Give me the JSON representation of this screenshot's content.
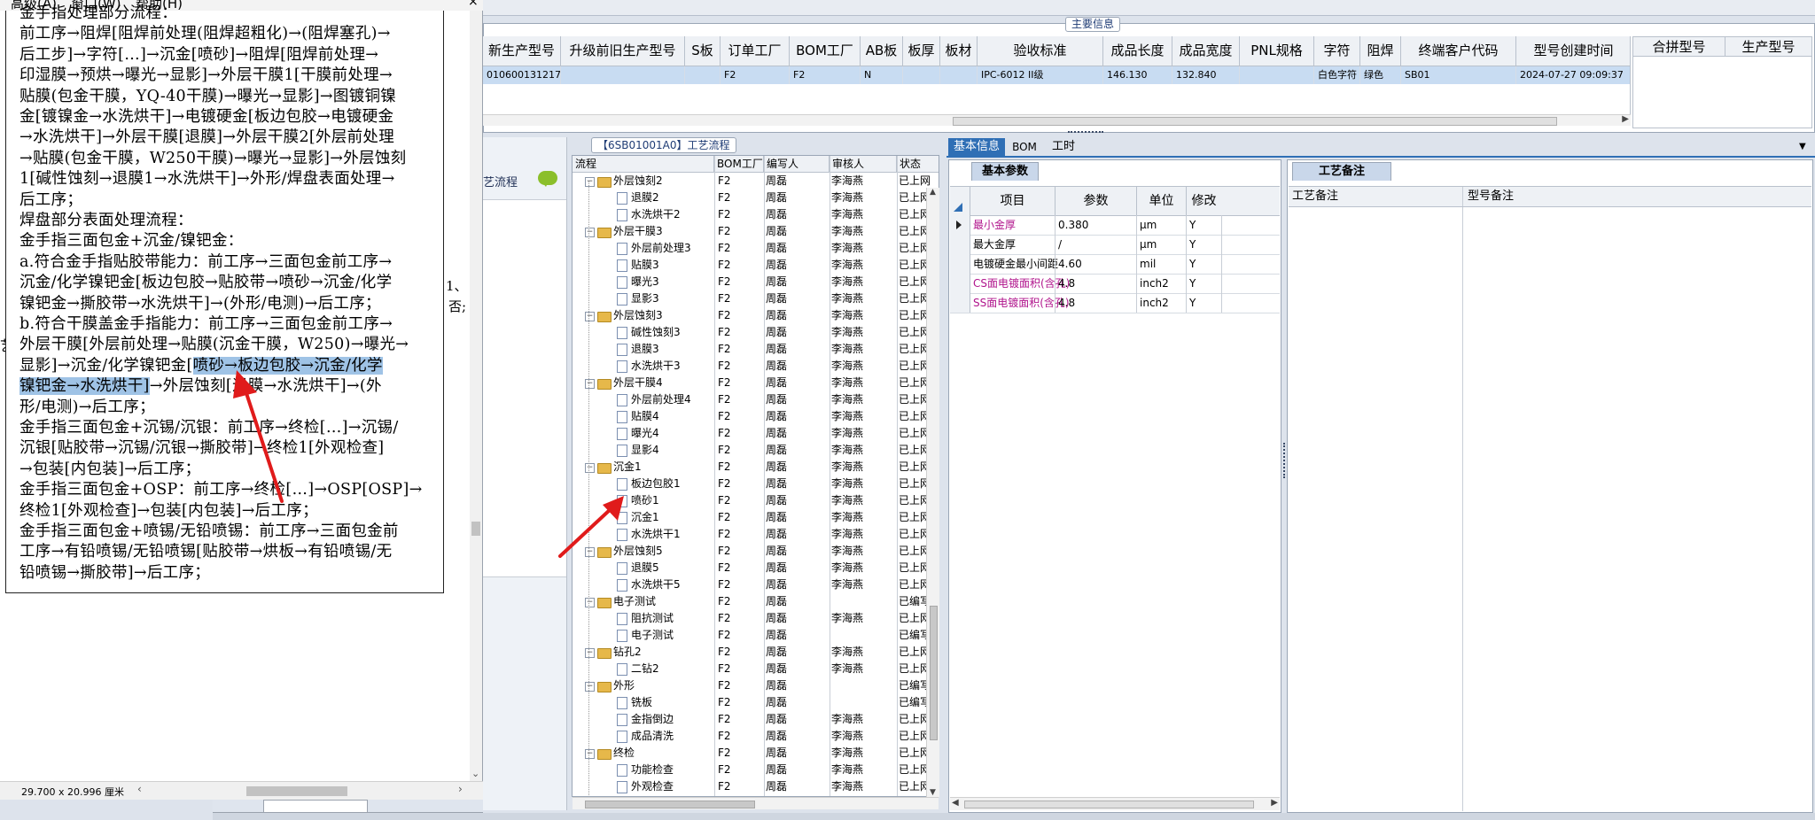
{
  "doc_panel": {
    "menu": [
      "高级(A)",
      "窗口(W)",
      "帮助(H)"
    ],
    "lines": [
      {
        "t": "金手指处理部分流程："
      },
      {
        "t": "前工序→阻焊[阻焊前处理(阻焊超粗化)→(阻焊塞孔)→"
      },
      {
        "t": "后工步]→字符[…]→沉金[喷砂]→阻焊[阻焊前处理→"
      },
      {
        "t": "印湿膜→预烘→曝光→显影]→外层干膜1[干膜前处理→"
      },
      {
        "t": "贴膜(包金干膜，YQ-40干膜)→曝光→显影]→图镀铜镍"
      },
      {
        "t": "金[镀镍金→水洗烘干]→电镀硬金[板边包胶→电镀硬金"
      },
      {
        "t": "→水洗烘干]→外层干膜[退膜]→外层干膜2[外层前处理"
      },
      {
        "t": "→贴膜(包金干膜，W250干膜)→曝光→显影]→外层蚀刻"
      },
      {
        "t": "1[碱性蚀刻→退膜1→水洗烘干]→外形/焊盘表面处理→"
      },
      {
        "t": "后工序；"
      },
      {
        "t": "焊盘部分表面处理流程："
      },
      {
        "t": "金手指三面包金+沉金/镍钯金："
      },
      {
        "t": "a.符合金手指贴胶带能力：前工序→三面包金前工序→"
      },
      {
        "t": "沉金/化学镍钯金[板边包胶→贴胶带→喷砂→沉金/化学"
      },
      {
        "t": "镍钯金→撕胶带→水洗烘干]→(外形/电测)→后工序；"
      },
      {
        "t": "b.符合干膜盖金手指能力：前工序→三面包金前工序→"
      },
      {
        "t": "外层干膜[外层前处理→贴膜(沉金干膜，W250)→曝光→"
      },
      {
        "pre": "显影]→沉金/化学镍钯金[",
        "hl": "喷砂→板边包胶→沉金/化学"
      },
      {
        "hl": "镍钯金→水洗烘干]",
        "post": "→外层蚀刻[退膜→水洗烘干]→(外"
      },
      {
        "t": "形/电测)→后工序；"
      },
      {
        "t": "金手指三面包金+沉锡/沉银：前工序→终检[…]→沉锡/"
      },
      {
        "t": "沉银[贴胶带→沉锡/沉银→撕胶带]→终检1[外观检查]"
      },
      {
        "t": "→包装[内包装]→后工序；"
      },
      {
        "t": "金手指三面包金+OSP：前工序→终检[…]→OSP[OSP]→"
      },
      {
        "t": "终检1[外观检查]→包装[内包装]→后工序；"
      },
      {
        "t": "金手指三面包金+喷锡/无铅喷锡：前工序→三面包金前"
      },
      {
        "t": "工序→有铅喷锡/无铅喷锡[贴胶带→烘板→有铅喷锡/无"
      },
      {
        "t": "铅喷锡→撕胶带]→后工序；"
      }
    ],
    "page_size": "29.700 x 20.996 厘米",
    "side_text": [
      "1、",
      "否;"
    ],
    "left_edge_char": "艺"
  },
  "main_info": {
    "title": "主要信息",
    "columns": [
      "新生产型号",
      "升级前旧生产型号",
      "S板",
      "订单工厂",
      "BOM工厂",
      "AB板",
      "板厚",
      "板材",
      "验收标准",
      "成品长度",
      "成品宽度",
      "PNL规格",
      "字符",
      "阻焊",
      "终端客户代码",
      "型号创建时间"
    ],
    "row": [
      "010600131217",
      "",
      "",
      "F2",
      "F2",
      "N",
      "",
      "",
      "IPC-6012 II级",
      "146.130",
      "132.840",
      "",
      "白色字符",
      "绿色",
      "SB01",
      "2024-07-27 09:09:37"
    ],
    "right_columns": [
      "合拼型号",
      "生产型号"
    ]
  },
  "process_flow": {
    "title": "【6SB01001A0】工艺流程",
    "left_label": "艺流程",
    "columns": [
      "流程",
      "BOM工厂",
      "编写人",
      "审核人",
      "状态"
    ],
    "rows": [
      {
        "level": 1,
        "name": "外层蚀刻2",
        "bom": "F2",
        "writer": "周磊",
        "reviewer": "李海燕",
        "status": "已上网"
      },
      {
        "level": 2,
        "name": "退膜2",
        "bom": "F2",
        "writer": "周磊",
        "reviewer": "李海燕",
        "status": "已上网"
      },
      {
        "level": 2,
        "name": "水洗烘干2",
        "bom": "F2",
        "writer": "周磊",
        "reviewer": "李海燕",
        "status": "已上网"
      },
      {
        "level": 1,
        "name": "外层干膜3",
        "bom": "F2",
        "writer": "周磊",
        "reviewer": "李海燕",
        "status": "已上网"
      },
      {
        "level": 2,
        "name": "外层前处理3",
        "bom": "F2",
        "writer": "周磊",
        "reviewer": "李海燕",
        "status": "已上网"
      },
      {
        "level": 2,
        "name": "贴膜3",
        "bom": "F2",
        "writer": "周磊",
        "reviewer": "李海燕",
        "status": "已上网"
      },
      {
        "level": 2,
        "name": "曝光3",
        "bom": "F2",
        "writer": "周磊",
        "reviewer": "李海燕",
        "status": "已上网"
      },
      {
        "level": 2,
        "name": "显影3",
        "bom": "F2",
        "writer": "周磊",
        "reviewer": "李海燕",
        "status": "已上网"
      },
      {
        "level": 1,
        "name": "外层蚀刻3",
        "bom": "F2",
        "writer": "周磊",
        "reviewer": "李海燕",
        "status": "已上网"
      },
      {
        "level": 2,
        "name": "碱性蚀刻3",
        "bom": "F2",
        "writer": "周磊",
        "reviewer": "李海燕",
        "status": "已上网"
      },
      {
        "level": 2,
        "name": "退膜3",
        "bom": "F2",
        "writer": "周磊",
        "reviewer": "李海燕",
        "status": "已上网"
      },
      {
        "level": 2,
        "name": "水洗烘干3",
        "bom": "F2",
        "writer": "周磊",
        "reviewer": "李海燕",
        "status": "已上网"
      },
      {
        "level": 1,
        "name": "外层干膜4",
        "bom": "F2",
        "writer": "周磊",
        "reviewer": "李海燕",
        "status": "已上网"
      },
      {
        "level": 2,
        "name": "外层前处理4",
        "bom": "F2",
        "writer": "周磊",
        "reviewer": "李海燕",
        "status": "已上网"
      },
      {
        "level": 2,
        "name": "贴膜4",
        "bom": "F2",
        "writer": "周磊",
        "reviewer": "李海燕",
        "status": "已上网"
      },
      {
        "level": 2,
        "name": "曝光4",
        "bom": "F2",
        "writer": "周磊",
        "reviewer": "李海燕",
        "status": "已上网"
      },
      {
        "level": 2,
        "name": "显影4",
        "bom": "F2",
        "writer": "周磊",
        "reviewer": "李海燕",
        "status": "已上网"
      },
      {
        "level": 1,
        "name": "沉金1",
        "bom": "F2",
        "writer": "周磊",
        "reviewer": "李海燕",
        "status": "已上网"
      },
      {
        "level": 2,
        "name": "板边包胶1",
        "bom": "F2",
        "writer": "周磊",
        "reviewer": "李海燕",
        "status": "已上网"
      },
      {
        "level": 2,
        "name": "喷砂1",
        "bom": "F2",
        "writer": "周磊",
        "reviewer": "李海燕",
        "status": "已上网"
      },
      {
        "level": 2,
        "name": "沉金1",
        "bom": "F2",
        "writer": "周磊",
        "reviewer": "李海燕",
        "status": "已上网"
      },
      {
        "level": 2,
        "name": "水洗烘干1",
        "bom": "F2",
        "writer": "周磊",
        "reviewer": "李海燕",
        "status": "已上网"
      },
      {
        "level": 1,
        "name": "外层蚀刻5",
        "bom": "F2",
        "writer": "周磊",
        "reviewer": "李海燕",
        "status": "已上网"
      },
      {
        "level": 2,
        "name": "退膜5",
        "bom": "F2",
        "writer": "周磊",
        "reviewer": "李海燕",
        "status": "已上网"
      },
      {
        "level": 2,
        "name": "水洗烘干5",
        "bom": "F2",
        "writer": "周磊",
        "reviewer": "李海燕",
        "status": "已上网"
      },
      {
        "level": 1,
        "name": "电子测试",
        "bom": "F2",
        "writer": "周磊",
        "reviewer": "",
        "status": "已编写"
      },
      {
        "level": 2,
        "name": "阻抗测试",
        "bom": "F2",
        "writer": "周磊",
        "reviewer": "李海燕",
        "status": "已上网"
      },
      {
        "level": 2,
        "name": "电子测试",
        "bom": "F2",
        "writer": "周磊",
        "reviewer": "",
        "status": "已编写"
      },
      {
        "level": 1,
        "name": "钻孔2",
        "bom": "F2",
        "writer": "周磊",
        "reviewer": "李海燕",
        "status": "已上网"
      },
      {
        "level": 2,
        "name": "二钻2",
        "bom": "F2",
        "writer": "周磊",
        "reviewer": "李海燕",
        "status": "已上网"
      },
      {
        "level": 1,
        "name": "外形",
        "bom": "F2",
        "writer": "周磊",
        "reviewer": "",
        "status": "已编写"
      },
      {
        "level": 2,
        "name": "铣板",
        "bom": "F2",
        "writer": "周磊",
        "reviewer": "",
        "status": "已编写"
      },
      {
        "level": 2,
        "name": "金指倒边",
        "bom": "F2",
        "writer": "周磊",
        "reviewer": "李海燕",
        "status": "已上网"
      },
      {
        "level": 2,
        "name": "成品清洗",
        "bom": "F2",
        "writer": "周磊",
        "reviewer": "李海燕",
        "status": "已上网"
      },
      {
        "level": 1,
        "name": "终检",
        "bom": "F2",
        "writer": "周磊",
        "reviewer": "李海燕",
        "status": "已上网"
      },
      {
        "level": 2,
        "name": "功能检查",
        "bom": "F2",
        "writer": "周磊",
        "reviewer": "李海燕",
        "status": "已上网"
      },
      {
        "level": 2,
        "name": "外观检查",
        "bom": "F2",
        "writer": "周磊",
        "reviewer": "李海燕",
        "status": "已上网"
      }
    ]
  },
  "basic": {
    "tabs": [
      "基本信息",
      "BOM",
      "工时"
    ],
    "subtab": "基本参数",
    "columns": [
      "项目",
      "参数",
      "单位",
      "修改"
    ],
    "rows": [
      {
        "item": "最小金厚",
        "value": "0.380",
        "unit": "μm",
        "mod": "Y",
        "color": "#b0148c"
      },
      {
        "item": "最大金厚",
        "value": "/",
        "unit": "μm",
        "mod": "Y",
        "color": "#000000"
      },
      {
        "item": "电镀硬金最小间距",
        "value": "4.60",
        "unit": "mil",
        "mod": "Y",
        "color": "#000000"
      },
      {
        "item": "CS面电镀面积(含孔)",
        "value": "4.8",
        "unit": "inch2",
        "mod": "Y",
        "color": "#b0148c"
      },
      {
        "item": "SS面电镀面积(含孔)",
        "value": "4.8",
        "unit": "inch2",
        "mod": "Y",
        "color": "#b0148c"
      }
    ]
  },
  "notes": {
    "tab": "工艺备注",
    "col1": "工艺备注",
    "col2": "型号备注"
  },
  "colors": {
    "accent_tab": "#2f6fb5",
    "highlight": "#9fc3e6",
    "arrow": "#e01b1b"
  }
}
